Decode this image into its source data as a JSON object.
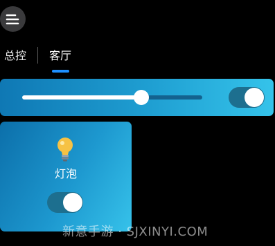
{
  "header": {
    "menu_icon": "menu-lines-icon"
  },
  "tabs": [
    {
      "label": "总控",
      "selected": false
    },
    {
      "label": "客厅",
      "selected": true
    }
  ],
  "colors": {
    "accent": "#1e90ff",
    "card_gradient_start": "#0f78b4",
    "card_gradient_end": "#35c3ea"
  },
  "master": {
    "brightness_fraction": 0.66,
    "power_on": true
  },
  "devices": [
    {
      "name": "灯泡",
      "icon": "light-bulb-icon",
      "power_on": true
    }
  ],
  "watermark": "新意手游 · SJXINYI.COM"
}
